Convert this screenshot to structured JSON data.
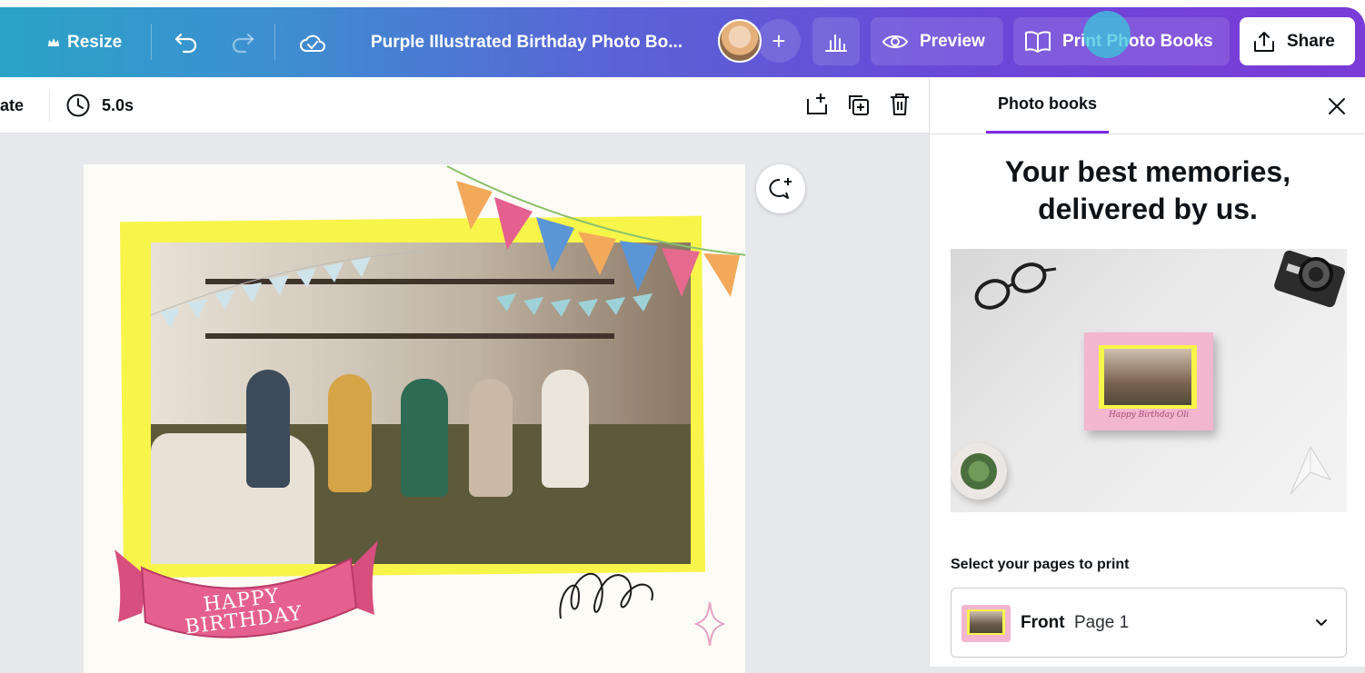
{
  "topbar": {
    "resize_label": "Resize",
    "doc_title": "Purple Illustrated Birthday Photo Bo...",
    "preview_label": "Preview",
    "print_label": "Print Photo Books",
    "share_label": "Share"
  },
  "subbar": {
    "animate_label": "ate",
    "duration": "5.0s"
  },
  "design": {
    "banner_line1": "HAPPY",
    "banner_line2": "BIRTHDAY"
  },
  "panel": {
    "tab_label": "Photo books",
    "headline": "Your best memories, delivered by us.",
    "mockup_caption": "Happy Birthday Oli",
    "select_label": "Select your pages to print",
    "select_value_main": "Front",
    "select_value_sub": "Page 1"
  },
  "colors": {
    "accent": "#7d2ae8",
    "gradient_start": "#2aa3c7",
    "gradient_end": "#7a3bd6",
    "highlight_yellow": "#f7f54a",
    "banner_pink": "#e5608e"
  }
}
